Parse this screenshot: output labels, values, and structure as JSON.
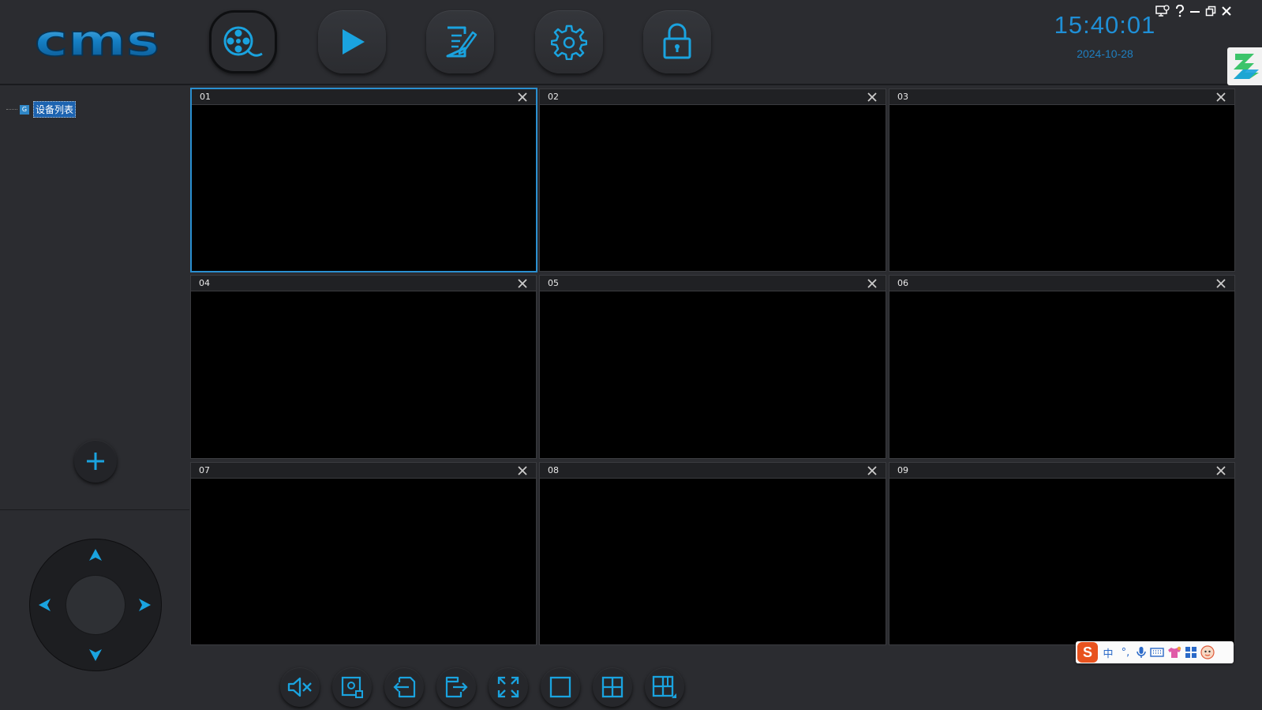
{
  "header": {
    "logo_text": "cms",
    "clock_time": "15:40:01",
    "clock_date": "2024-10-28",
    "nav": [
      {
        "name": "preview",
        "icon": "film-reel-icon",
        "active": true
      },
      {
        "name": "playback",
        "icon": "play-icon",
        "active": false
      },
      {
        "name": "log",
        "icon": "document-edit-icon",
        "active": false
      },
      {
        "name": "settings",
        "icon": "gear-icon",
        "active": false
      },
      {
        "name": "lock",
        "icon": "padlock-icon",
        "active": false
      }
    ],
    "window_controls": [
      "monitor-settings-icon",
      "help-icon",
      "minimize-icon",
      "restore-icon",
      "close-icon"
    ]
  },
  "sidebar": {
    "tree_root_label": "设备列表",
    "tree_icon_letter": "G",
    "add_button_icon": "plus-icon",
    "ptz": [
      "arrow-up-icon",
      "arrow-down-icon",
      "arrow-left-icon",
      "arrow-right-icon"
    ]
  },
  "grid": {
    "cells": [
      {
        "label": "01",
        "selected": true
      },
      {
        "label": "02",
        "selected": false
      },
      {
        "label": "03",
        "selected": false
      },
      {
        "label": "04",
        "selected": false
      },
      {
        "label": "05",
        "selected": false
      },
      {
        "label": "06",
        "selected": false
      },
      {
        "label": "07",
        "selected": false
      },
      {
        "label": "08",
        "selected": false
      },
      {
        "label": "09",
        "selected": false
      }
    ]
  },
  "toolbar": {
    "buttons": [
      "mute-icon",
      "snapshot-icon",
      "import-icon",
      "export-icon",
      "fullscreen-icon",
      "layout-1-icon",
      "layout-4-icon",
      "layout-custom-icon"
    ]
  },
  "ime": {
    "logo": "S",
    "lang": "中",
    "punct": "°,"
  },
  "colors": {
    "accent": "#1aa3df",
    "background": "#2b2c30",
    "selected_border": "#2a8fd0"
  }
}
